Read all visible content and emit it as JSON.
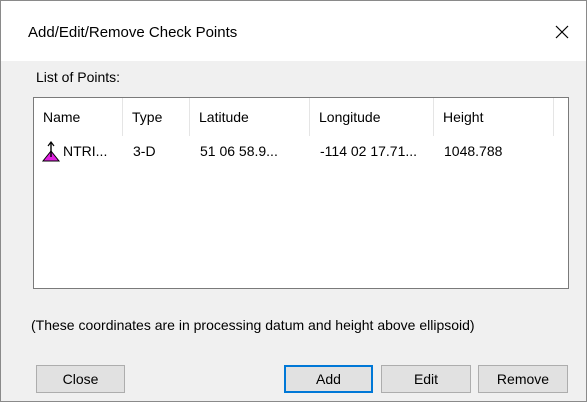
{
  "window": {
    "title": "Add/Edit/Remove Check Points"
  },
  "list": {
    "label": "List of Points:",
    "columns": [
      "Name",
      "Type",
      "Latitude",
      "Longitude",
      "Height"
    ],
    "rows": [
      {
        "icon": "survey-point-icon",
        "name": "NTRI...",
        "type": "3-D",
        "latitude": "51 06 58.9...",
        "longitude": "-114 02 17.71...",
        "height": "1048.788"
      }
    ]
  },
  "note": "(These coordinates are in processing datum and height above ellipsoid)",
  "buttons": {
    "close": "Close",
    "add": "Add",
    "edit": "Edit",
    "remove": "Remove"
  },
  "colors": {
    "accent": "#0078d7",
    "point_icon": "#e020e0"
  }
}
